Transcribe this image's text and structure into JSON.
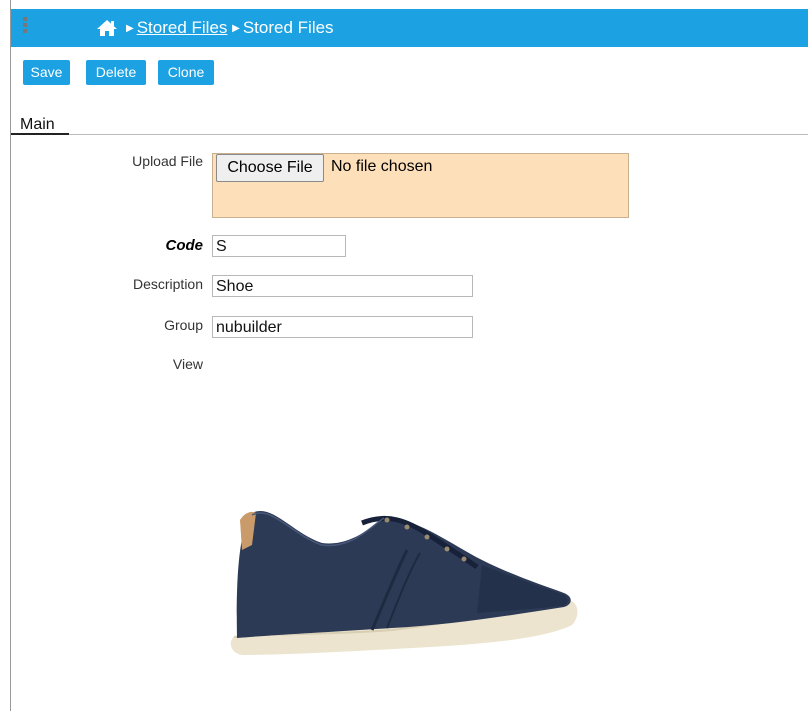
{
  "header": {
    "breadcrumb": [
      "Stored Files",
      "Stored Files"
    ]
  },
  "toolbar": {
    "save_label": "Save",
    "delete_label": "Delete",
    "clone_label": "Clone"
  },
  "tabs": [
    {
      "label": "Main"
    }
  ],
  "form": {
    "upload_label": "Upload File",
    "choose_file_label": "Choose File",
    "no_file_text": "No file chosen",
    "code_label": "Code",
    "code_value": "S",
    "description_label": "Description",
    "description_value": "Shoe",
    "group_label": "Group",
    "group_value": "nubuilder",
    "view_label": "View"
  },
  "colors": {
    "accent": "#1ca1e2",
    "upload_bg": "#fde0ba"
  }
}
